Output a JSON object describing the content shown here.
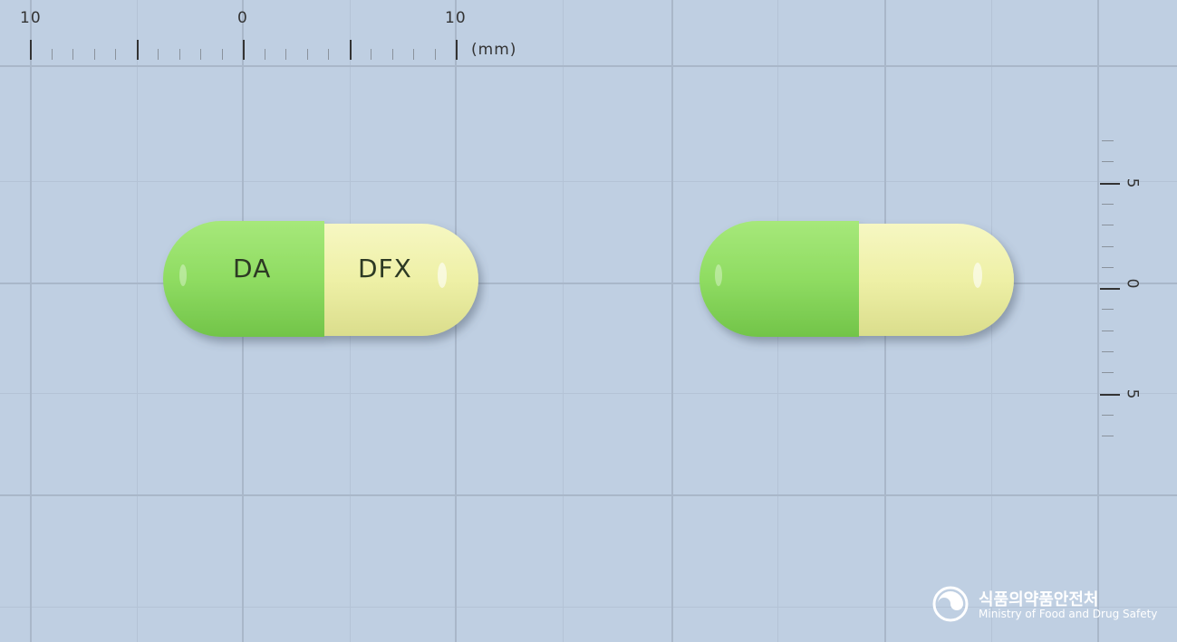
{
  "ruler_top": {
    "numbers": [
      "10",
      "0",
      "10"
    ],
    "unit": "(mm)"
  },
  "ruler_right": {
    "numbers": [
      "5",
      "0",
      "5"
    ]
  },
  "capsule_front": {
    "left_imprint": "DA",
    "right_imprint": "DFX",
    "cap_color": "#8fdc62",
    "body_color": "#eef0a6"
  },
  "capsule_back": {
    "cap_color": "#8fdc62",
    "body_color": "#eef0a6"
  },
  "watermark": {
    "korean": "식품의약품안전처",
    "english": "Ministry of Food and Drug Safety"
  }
}
